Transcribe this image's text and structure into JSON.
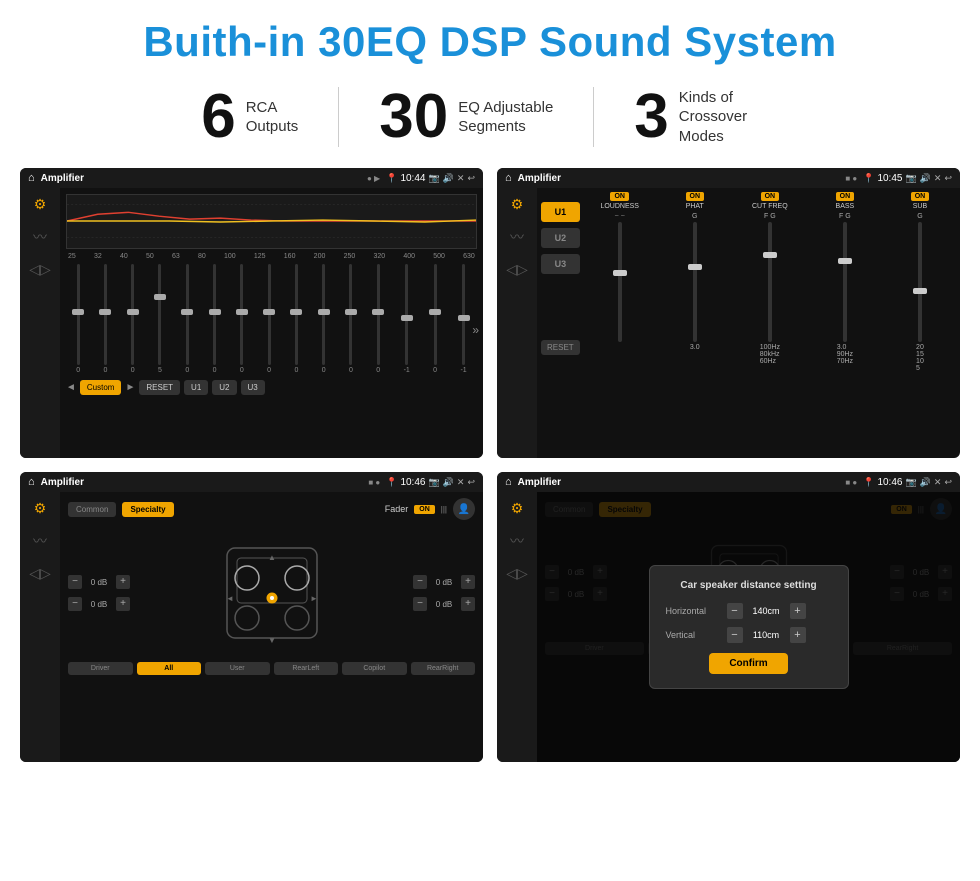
{
  "header": {
    "title": "Buith-in 30EQ DSP Sound System"
  },
  "stats": [
    {
      "number": "6",
      "label1": "RCA",
      "label2": "Outputs"
    },
    {
      "number": "30",
      "label1": "EQ Adjustable",
      "label2": "Segments"
    },
    {
      "number": "3",
      "label1": "Kinds of",
      "label2": "Crossover Modes"
    }
  ],
  "screens": {
    "screen1": {
      "app": "Amplifier",
      "time": "10:44",
      "eq_freqs": [
        "25",
        "32",
        "40",
        "50",
        "63",
        "80",
        "100",
        "125",
        "160",
        "200",
        "250",
        "320",
        "400",
        "500",
        "630"
      ],
      "eq_values": [
        "0",
        "0",
        "0",
        "5",
        "0",
        "0",
        "0",
        "0",
        "0",
        "0",
        "0",
        "0",
        "-1",
        "0",
        "-1"
      ],
      "buttons": [
        "Custom",
        "RESET",
        "U1",
        "U2",
        "U3"
      ]
    },
    "screen2": {
      "app": "Amplifier",
      "time": "10:45",
      "u_buttons": [
        "U1",
        "U2",
        "U3"
      ],
      "controls": [
        "LOUDNESS",
        "PHAT",
        "CUT FREQ",
        "BASS",
        "SUB"
      ]
    },
    "screen3": {
      "app": "Amplifier",
      "time": "10:46",
      "tabs": [
        "Common",
        "Specialty"
      ],
      "fader_label": "Fader",
      "on": "ON",
      "db_values": [
        "0 dB",
        "0 dB",
        "0 dB",
        "0 dB"
      ],
      "bottom_btns": [
        "Driver",
        "All",
        "User",
        "RearLeft",
        "RearRight",
        "Copilot"
      ]
    },
    "screen4": {
      "app": "Amplifier",
      "time": "10:46",
      "tabs": [
        "Common",
        "Specialty"
      ],
      "dialog": {
        "title": "Car speaker distance setting",
        "horizontal_label": "Horizontal",
        "horizontal_value": "140cm",
        "vertical_label": "Vertical",
        "vertical_value": "110cm",
        "confirm": "Confirm"
      }
    }
  }
}
